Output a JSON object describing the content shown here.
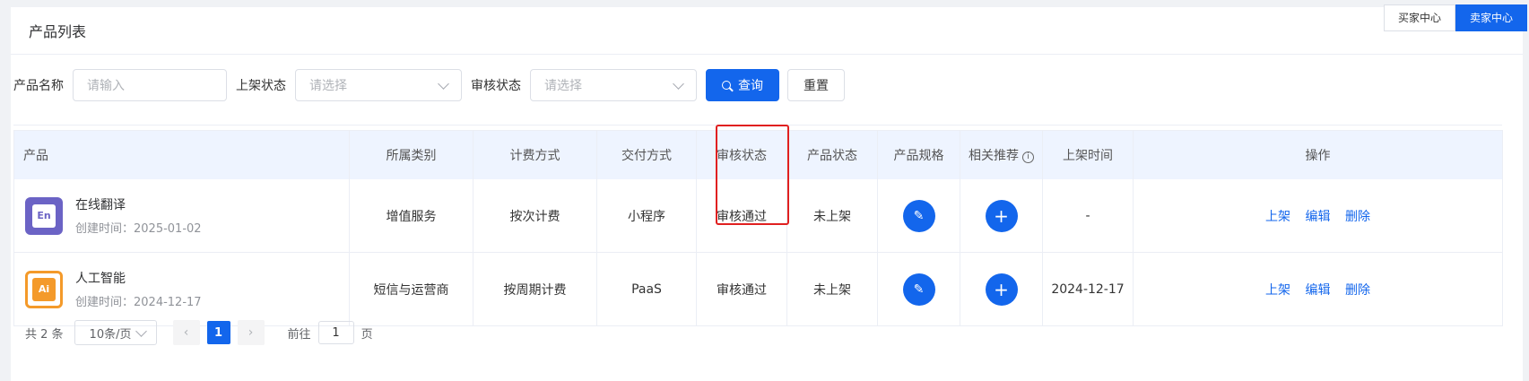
{
  "topbar": {
    "buyer": "买家中心",
    "seller": "卖家中心"
  },
  "card": {
    "title": "产品列表"
  },
  "filters": {
    "product_name_label": "产品名称",
    "product_name_placeholder": "请输入",
    "shelf_status_label": "上架状态",
    "shelf_status_placeholder": "请选择",
    "audit_status_label": "审核状态",
    "audit_status_placeholder": "请选择",
    "query_button": "查询",
    "reset_button": "重置"
  },
  "table": {
    "columns": [
      "产品",
      "所属类别",
      "计费方式",
      "交付方式",
      "审核状态",
      "产品状态",
      "产品规格",
      "相关推荐",
      "上架时间",
      "操作"
    ],
    "rows": [
      {
        "logo": "En",
        "name": "在线翻译",
        "created": "创建时间：2025-01-02",
        "category": "增值服务",
        "billing": "按次计费",
        "delivery": "小程序",
        "audit": "审核通过",
        "status": "未上架",
        "listed": "-",
        "ops": [
          "上架",
          "编辑",
          "删除"
        ]
      },
      {
        "logo": "Ai",
        "name": "人工智能",
        "created": "创建时间：2024-12-17",
        "category": "短信与运营商",
        "billing": "按周期计费",
        "delivery": "PaaS",
        "audit": "审核通过",
        "status": "未上架",
        "listed": "2024-12-17",
        "ops": [
          "上架",
          "编辑",
          "删除"
        ]
      }
    ]
  },
  "pager": {
    "total": "共 2 条",
    "page_size": "10条/页",
    "current": "1",
    "goto_label": "前往",
    "goto_value": "1",
    "goto_suffix": "页"
  },
  "colors": {
    "primary": "#1366ec",
    "success": "#67c23a",
    "highlight": "#e02020"
  }
}
